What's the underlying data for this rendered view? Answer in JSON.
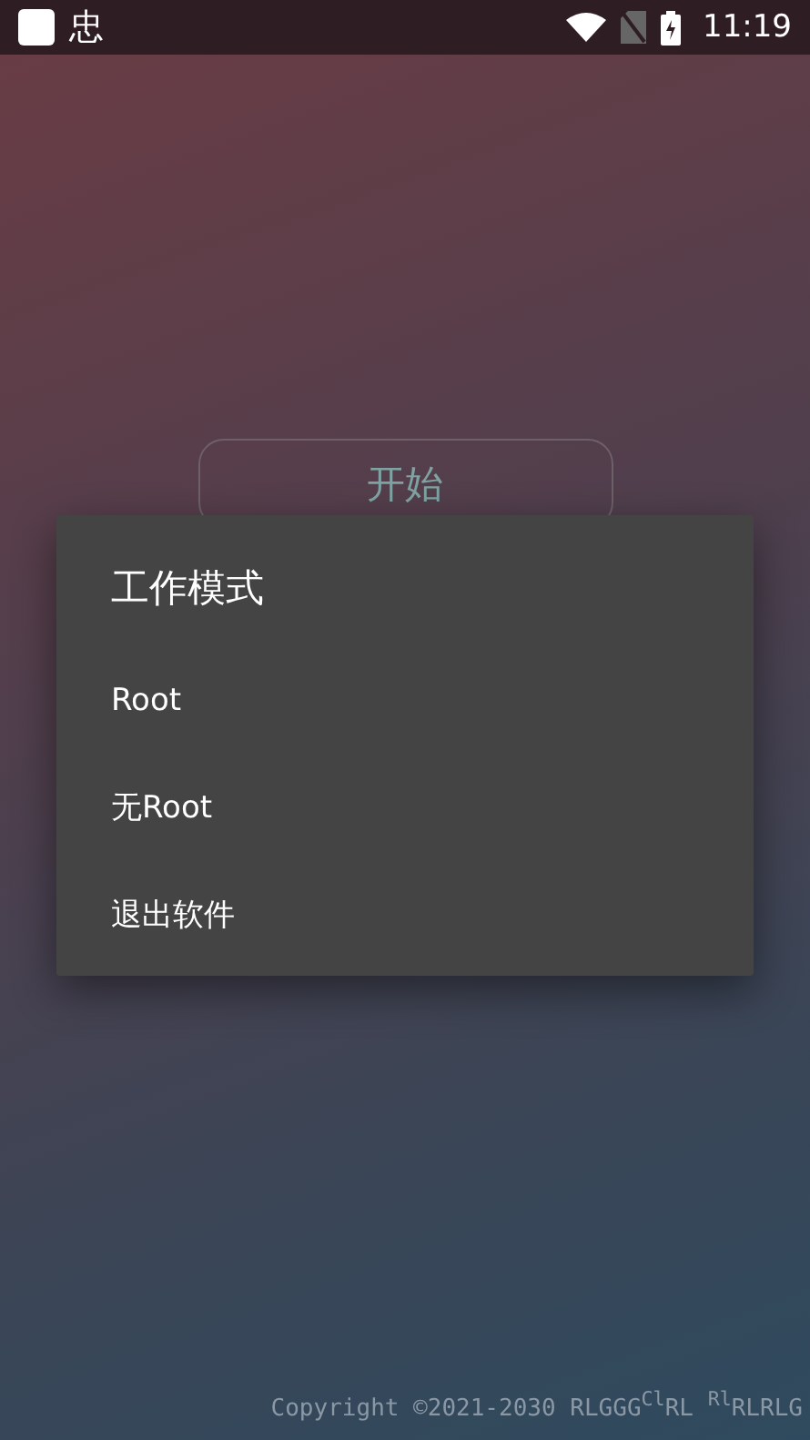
{
  "status_bar": {
    "notification_glyph": "忠",
    "time": "11:19"
  },
  "start_button": {
    "label": "开始"
  },
  "dialog": {
    "title": "工作模式",
    "items": [
      {
        "label": "Root"
      },
      {
        "label": "无Root"
      },
      {
        "label": "退出软件"
      }
    ]
  },
  "footer": {
    "copyright": "Copyright ©2021-2030 RLGGG$^{Cl}$RL $^{Rl}$RLRLG"
  }
}
